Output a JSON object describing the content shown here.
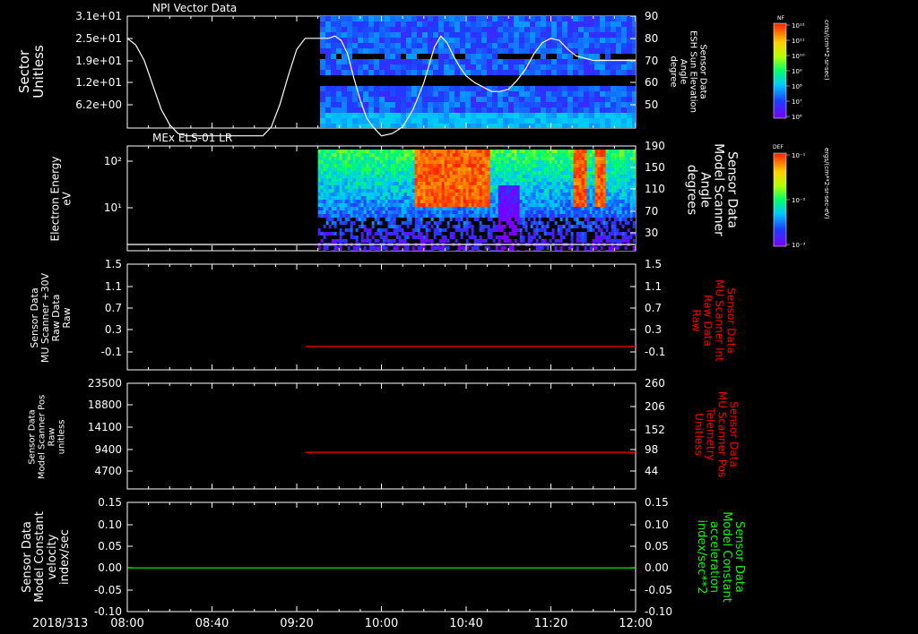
{
  "window": {
    "date_label": "2018/313"
  },
  "colors": {
    "white": "#ffffff",
    "red": "#ff0000",
    "green": "#00ff00",
    "panel_bg": "#000000"
  },
  "chart_data": [
    {
      "type": "line",
      "title": "NPI Vector Data",
      "ylabel_left": [
        "Sector",
        "Unitless"
      ],
      "ylabel_right": [
        "Sensor Data",
        "ESH Sun Elevation",
        "Angle",
        "degree"
      ],
      "left_ticks": [
        "3.1e+01",
        "2.5e+01",
        "1.9e+01",
        "1.2e+01",
        "6.2e+00"
      ],
      "right_ticks": [
        "90",
        "80",
        "70",
        "60",
        "50"
      ],
      "ylim_right": [
        40,
        90
      ],
      "spectrogram_start": "09:31",
      "colorbar": {
        "label": "NF",
        "units": "cnts/(cm**2-sr-sec)",
        "ticks": [
          "10¹²",
          "10¹¹",
          "10¹⁰",
          "10⁹",
          "10⁸",
          "10⁷",
          "10⁶"
        ]
      },
      "series": [
        {
          "color": "white",
          "x": [
            "08:00",
            "08:04",
            "08:08",
            "08:12",
            "08:16",
            "08:20",
            "08:24",
            "08:28",
            "08:32",
            "08:40",
            "08:48",
            "08:56",
            "09:04",
            "09:08",
            "09:12",
            "09:16",
            "09:20",
            "09:24",
            "09:28",
            "09:32",
            "09:35",
            "09:38",
            "09:41",
            "09:44",
            "09:47",
            "09:50",
            "09:53",
            "09:56",
            "10:00",
            "10:05",
            "10:10",
            "10:15",
            "10:20",
            "10:25",
            "10:28",
            "10:31",
            "10:34",
            "10:37",
            "10:40",
            "10:44",
            "10:48",
            "10:52",
            "10:56",
            "11:00",
            "11:04",
            "11:08",
            "11:12",
            "11:16",
            "11:20",
            "11:24",
            "11:28",
            "11:32",
            "11:36",
            "11:40",
            "11:44",
            "11:48",
            "11:52",
            "11:56",
            "12:00"
          ],
          "values": [
            80,
            77,
            70,
            59,
            48,
            41,
            37,
            36,
            36,
            36,
            36,
            36,
            36,
            40,
            50,
            63,
            75,
            80,
            80,
            80,
            80,
            81,
            79,
            73,
            62,
            52,
            44,
            40,
            36,
            37,
            40,
            48,
            60,
            76,
            81,
            78,
            72,
            67,
            63,
            60,
            58,
            56,
            56,
            57,
            61,
            66,
            73,
            78,
            80,
            79,
            75,
            72,
            71,
            70,
            70,
            70,
            70,
            70,
            70
          ]
        }
      ]
    },
    {
      "type": "heatmap",
      "title": "MEx ELS-01 LR",
      "ylabel_left": [
        "Electron Energy",
        "eV"
      ],
      "ylabel_right": [
        "Sensor Data",
        "Model Scanner",
        "Angle",
        "degrees"
      ],
      "left_ticks": [
        "10²",
        "10¹"
      ],
      "right_ticks": [
        "190",
        "150",
        "110",
        "70",
        "30"
      ],
      "data_start": "09:30",
      "colorbar": {
        "label": "DEF",
        "units": "ergs/(cm**2-sr-sec-eV)",
        "ticks": [
          "10⁻¹",
          "10⁻²",
          "10⁻³"
        ]
      },
      "series": [
        {
          "color": "white",
          "x": [
            "08:00",
            "12:00"
          ],
          "values": [
            10,
            10
          ]
        }
      ]
    },
    {
      "type": "line",
      "ylabel_left": [
        "Sensor Data",
        "MU Scanner +30V",
        "Raw Data",
        "Raw"
      ],
      "ylabel_right": [
        "Sensor Data",
        "MU Scanner Int",
        "Raw Data",
        "Raw"
      ],
      "left_ticks": [
        "1.5",
        "1.1",
        "0.7",
        "0.3",
        "-0.1"
      ],
      "right_ticks": [
        "1.5",
        "1.1",
        "0.7",
        "0.3",
        "-0.1"
      ],
      "ylim": [
        -0.3,
        1.5
      ],
      "series": [
        {
          "color": "red",
          "x": [
            "09:24",
            "12:00"
          ],
          "values": [
            0.0,
            0.0
          ]
        }
      ]
    },
    {
      "type": "line",
      "ylabel_left": [
        "Sensor Data",
        "Model Scanner Pos",
        "Raw",
        "unitless"
      ],
      "ylabel_right": [
        "Sensor Data",
        "MU Scanner Pos",
        "Telemetry",
        "Unitless"
      ],
      "left_ticks": [
        "23500",
        "18800",
        "14100",
        "9400",
        "4700"
      ],
      "right_ticks": [
        "260",
        "206",
        "152",
        "98",
        "44"
      ],
      "ylim_right": [
        -10,
        260
      ],
      "series": [
        {
          "color": "red",
          "x": [
            "09:24",
            "12:00"
          ],
          "values": [
            90,
            90
          ]
        }
      ]
    },
    {
      "type": "line",
      "ylabel_left": [
        "Sensor Data",
        "Model Constant",
        "velocity",
        "index/sec"
      ],
      "ylabel_right": [
        "Sensor Data",
        "Model Constant",
        "acceleration",
        "index/sec**2"
      ],
      "left_ticks": [
        "0.15",
        "0.10",
        "0.05",
        "0.00",
        "-0.05",
        "-0.10"
      ],
      "right_ticks": [
        "0.15",
        "0.10",
        "0.05",
        "0.00",
        "-0.05",
        "-0.10"
      ],
      "ylim": [
        -0.1,
        0.15
      ],
      "x_ticks": [
        "08:00",
        "08:40",
        "09:20",
        "10:00",
        "10:40",
        "11:20",
        "12:00"
      ],
      "series": [
        {
          "color": "green",
          "x": [
            "08:00",
            "12:00"
          ],
          "values": [
            0.0,
            0.0
          ]
        }
      ]
    }
  ]
}
